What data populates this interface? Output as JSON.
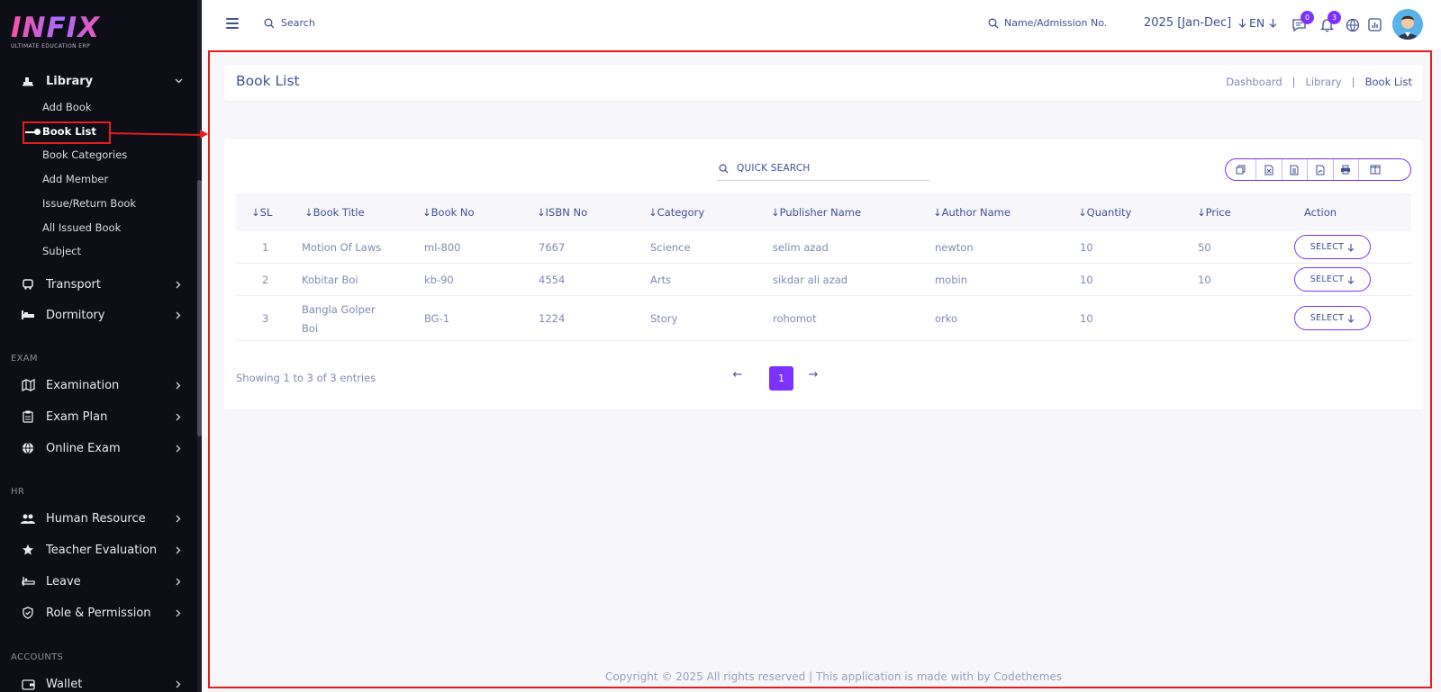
{
  "brand": {
    "name": "INFIX",
    "tagline": "ULTIMATE EDUCATION ERP"
  },
  "sidebar": {
    "library": {
      "label": "Library",
      "icon": "library-icon"
    },
    "library_items": [
      {
        "label": "Add Book"
      },
      {
        "label": "Book List",
        "active": true
      },
      {
        "label": "Book Categories"
      },
      {
        "label": "Add Member"
      },
      {
        "label": "Issue/Return Book"
      },
      {
        "label": "All Issued Book"
      },
      {
        "label": "Subject"
      }
    ],
    "menus_top": [
      {
        "label": "Transport",
        "icon": "bus-icon"
      },
      {
        "label": "Dormitory",
        "icon": "bed-icon"
      }
    ],
    "section_exam": "EXAM",
    "menus_exam": [
      {
        "label": "Examination",
        "icon": "map-icon"
      },
      {
        "label": "Exam Plan",
        "icon": "clipboard-icon"
      },
      {
        "label": "Online Exam",
        "icon": "globe-icon"
      }
    ],
    "section_hr": "HR",
    "menus_hr": [
      {
        "label": "Human Resource",
        "icon": "users-icon"
      },
      {
        "label": "Teacher Evaluation",
        "icon": "star-icon"
      },
      {
        "label": "Leave",
        "icon": "leave-icon"
      },
      {
        "label": "Role & Permission",
        "icon": "shield-icon"
      }
    ],
    "section_accounts": "ACCOUNTS",
    "menus_accounts": [
      {
        "label": "Wallet",
        "icon": "wallet-icon"
      }
    ]
  },
  "header": {
    "search_label": "Search",
    "name_search_label": "Name/Admission No.",
    "session": "2025 [Jan-Dec]",
    "language": "EN",
    "message_count": "0",
    "notification_count": "3"
  },
  "page": {
    "title": "Book List",
    "breadcrumbs": [
      "Dashboard",
      "Library",
      "Book List"
    ]
  },
  "table": {
    "quick_search_placeholder": "QUICK SEARCH",
    "export_buttons": [
      "copy-icon",
      "excel-icon",
      "csv-icon",
      "pdf-icon",
      "print-icon",
      "columns-icon"
    ],
    "columns": [
      "SL",
      "Book Title",
      "Book No",
      "ISBN No",
      "Category",
      "Publisher Name",
      "Author Name",
      "Quantity",
      "Price",
      "Action"
    ],
    "rows": [
      {
        "sl": "1",
        "title": "Motion Of Laws",
        "title2": "",
        "book_no": "ml-800",
        "isbn": "7667",
        "category": "Science",
        "publisher": "selim azad",
        "author": "newton",
        "quantity": "10",
        "price": "50",
        "action": "SELECT"
      },
      {
        "sl": "2",
        "title": "Kobitar Boi",
        "title2": "",
        "book_no": "kb-90",
        "isbn": "4554",
        "category": "Arts",
        "publisher": "sikdar ali azad",
        "author": "mobin",
        "quantity": "10",
        "price": "10",
        "action": "SELECT"
      },
      {
        "sl": "3",
        "title": "Bangla Golper",
        "title2": "Boi",
        "book_no": "BG-1",
        "isbn": "1224",
        "category": "Story",
        "publisher": "rohomot",
        "author": "orko",
        "quantity": "10",
        "price": "",
        "action": "SELECT"
      }
    ],
    "showing": "Showing 1 to 3 of 3 entries",
    "current_page": "1"
  },
  "footer": {
    "text": "Copyright © 2025 All rights reserved | This application is made with by Codethemes"
  },
  "colors": {
    "accent": "#7c32ff",
    "text": "#415094",
    "muted": "#828bb2",
    "highlight": "#e51d1d",
    "sidebar_bg": "#0e0f16"
  }
}
